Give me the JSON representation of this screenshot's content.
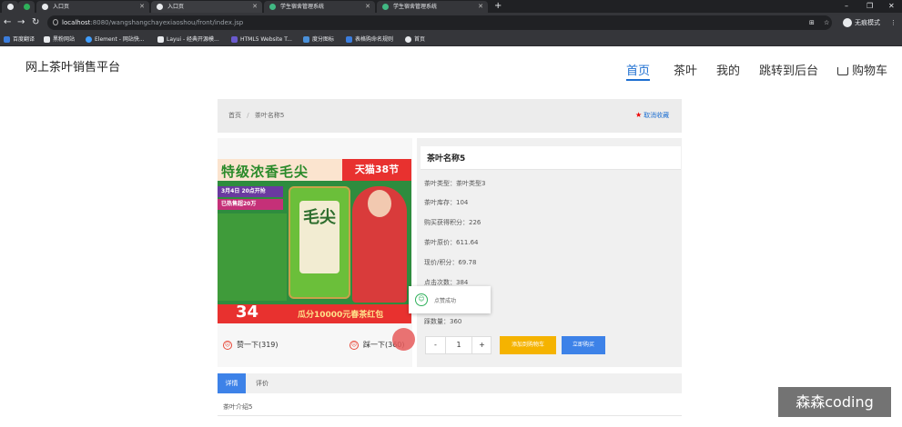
{
  "browser": {
    "tabs": [
      {
        "label": ""
      },
      {
        "label": ""
      },
      {
        "label": "入口页"
      },
      {
        "label": "入口页"
      },
      {
        "label": "学生宿舍管理系统"
      },
      {
        "label": "学生宿舍管理系统"
      }
    ],
    "new_tab": "+",
    "window_controls": [
      "–",
      "❐",
      "✕"
    ],
    "url_host": "localhost",
    "url_path": ":8080/wangshangchayexiaoshou/front/index.jsp",
    "incognito_label": "无痕模式",
    "bookmarks": [
      {
        "label": "百度翻译",
        "color": "#3b7ddd"
      },
      {
        "label": "黑粉网站",
        "color": "#222222"
      },
      {
        "label": "Element - 网站快...",
        "color": "#409eff"
      },
      {
        "label": "Layui - 经典开源模...",
        "color": "#222222"
      },
      {
        "label": "HTML5 Website T...",
        "color": "#6a5acd"
      },
      {
        "label": "度分图标",
        "color": "#4a90d9"
      },
      {
        "label": "表格购命名规则",
        "color": "#3b7ddd"
      },
      {
        "label": "首页",
        "color": "#e8eaed"
      }
    ]
  },
  "site": {
    "title": "网上茶叶销售平台",
    "nav": [
      {
        "label": "首页",
        "active": true
      },
      {
        "label": "茶叶"
      },
      {
        "label": "我的"
      },
      {
        "label": "跳转到后台"
      },
      {
        "label": "购物车"
      }
    ]
  },
  "breadcrumb": {
    "home": "首页",
    "separator": "/",
    "current": "茶叶名称5",
    "favorite_label": "取消收藏",
    "favorite_icon": "★"
  },
  "product_image": {
    "headline": "特级浓香毛尖",
    "tag": "天猫38节",
    "date_line": "3月4日 20点开抢",
    "sold_line": "已热售超20万",
    "can_text": "毛尖",
    "bottom_number": "34",
    "bottom_text": "瓜分10000元春茶红包"
  },
  "votes": {
    "like": "赞一下(319)",
    "dislike": "踩一下(360)"
  },
  "product": {
    "name": "茶叶名称5",
    "attributes": [
      "茶叶类型：茶叶类型3",
      "茶叶库存：104",
      "购买获得积分：226",
      "茶叶原价：611.64",
      "现价/积分：69.78",
      "点击次数：384",
      "",
      "踩数量：360"
    ]
  },
  "toast": {
    "message": "点赞成功"
  },
  "purchase": {
    "minus": "-",
    "quantity": "1",
    "plus": "+",
    "add_to_cart": "添加到购物车",
    "buy_now": "立即购买"
  },
  "details": {
    "tabs": [
      "详情",
      "评价"
    ],
    "description": "茶叶介绍5"
  },
  "watermark": "森森coding"
}
